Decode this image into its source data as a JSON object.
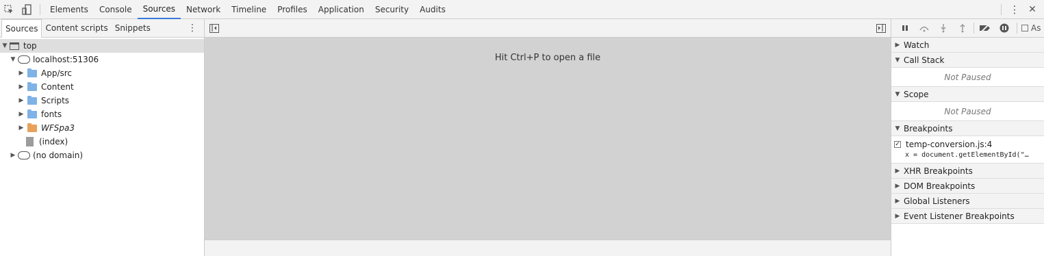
{
  "topbar": {
    "tabs": [
      "Elements",
      "Console",
      "Sources",
      "Network",
      "Timeline",
      "Profiles",
      "Application",
      "Security",
      "Audits"
    ],
    "active_tab": "Sources",
    "icons": [
      "inspect-element-icon",
      "device-mode-icon",
      "more-vertical-icon",
      "close-icon"
    ],
    "more_glyph": "⋮",
    "close_glyph": "✕"
  },
  "navigator": {
    "tabs": [
      "Sources",
      "Content scripts",
      "Snippets"
    ],
    "more_glyph": "⋮",
    "tree": {
      "top": "top",
      "host": "localhost:51306",
      "items": [
        "App/src",
        "Content",
        "Scripts",
        "fonts",
        "WFSpa3",
        "(index)"
      ],
      "no_domain": "(no domain)"
    }
  },
  "editor": {
    "hint": "Hit Ctrl+P to open a file"
  },
  "debugger": {
    "async_label": "As",
    "sections": {
      "watch": "Watch",
      "call_stack": "Call Stack",
      "call_stack_status": "Not Paused",
      "scope": "Scope",
      "scope_status": "Not Paused",
      "breakpoints": "Breakpoints",
      "breakpoint_file": "temp-conversion.js:4",
      "breakpoint_code": "x = document.getElementById(\"…",
      "xhr": "XHR Breakpoints",
      "dom": "DOM Breakpoints",
      "global": "Global Listeners",
      "event": "Event Listener Breakpoints"
    }
  },
  "colors": {
    "accent": "#3879d9",
    "folder": "#7fb2e5",
    "folder_alt": "#e8a15a",
    "editor_bg": "#d2d2d2"
  }
}
